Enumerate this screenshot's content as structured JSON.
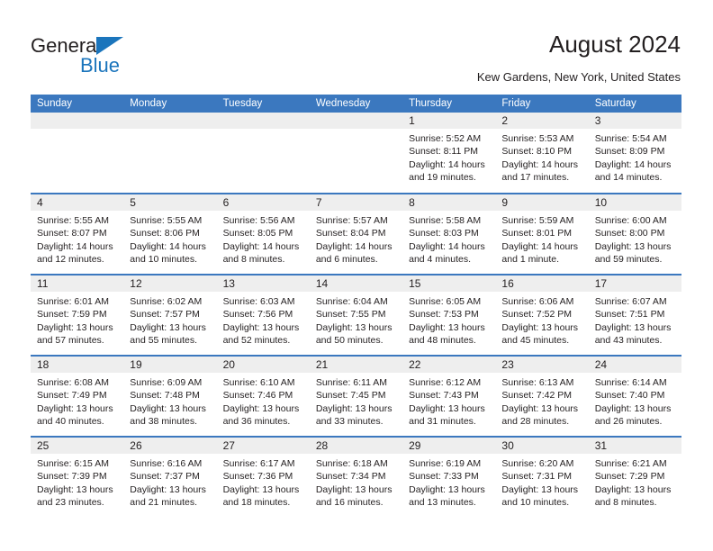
{
  "brand": {
    "name_top": "General",
    "name_bottom": "Blue",
    "triangle_icon": "triangle-icon",
    "color_dark": "#231f20",
    "color_blue": "#1b75bc"
  },
  "header": {
    "title": "August 2024",
    "subtitle": "Kew Gardens, New York, United States"
  },
  "calendar": {
    "header_bg": "#3b78bf",
    "daynum_bg": "#eeeeee",
    "weekday_headers": [
      "Sunday",
      "Monday",
      "Tuesday",
      "Wednesday",
      "Thursday",
      "Friday",
      "Saturday"
    ],
    "weeks": [
      [
        {
          "empty": true
        },
        {
          "empty": true
        },
        {
          "empty": true
        },
        {
          "empty": true
        },
        {
          "day": "1",
          "sunrise": "Sunrise: 5:52 AM",
          "sunset": "Sunset: 8:11 PM",
          "daylight1": "Daylight: 14 hours",
          "daylight2": "and 19 minutes."
        },
        {
          "day": "2",
          "sunrise": "Sunrise: 5:53 AM",
          "sunset": "Sunset: 8:10 PM",
          "daylight1": "Daylight: 14 hours",
          "daylight2": "and 17 minutes."
        },
        {
          "day": "3",
          "sunrise": "Sunrise: 5:54 AM",
          "sunset": "Sunset: 8:09 PM",
          "daylight1": "Daylight: 14 hours",
          "daylight2": "and 14 minutes."
        }
      ],
      [
        {
          "day": "4",
          "sunrise": "Sunrise: 5:55 AM",
          "sunset": "Sunset: 8:07 PM",
          "daylight1": "Daylight: 14 hours",
          "daylight2": "and 12 minutes."
        },
        {
          "day": "5",
          "sunrise": "Sunrise: 5:55 AM",
          "sunset": "Sunset: 8:06 PM",
          "daylight1": "Daylight: 14 hours",
          "daylight2": "and 10 minutes."
        },
        {
          "day": "6",
          "sunrise": "Sunrise: 5:56 AM",
          "sunset": "Sunset: 8:05 PM",
          "daylight1": "Daylight: 14 hours",
          "daylight2": "and 8 minutes."
        },
        {
          "day": "7",
          "sunrise": "Sunrise: 5:57 AM",
          "sunset": "Sunset: 8:04 PM",
          "daylight1": "Daylight: 14 hours",
          "daylight2": "and 6 minutes."
        },
        {
          "day": "8",
          "sunrise": "Sunrise: 5:58 AM",
          "sunset": "Sunset: 8:03 PM",
          "daylight1": "Daylight: 14 hours",
          "daylight2": "and 4 minutes."
        },
        {
          "day": "9",
          "sunrise": "Sunrise: 5:59 AM",
          "sunset": "Sunset: 8:01 PM",
          "daylight1": "Daylight: 14 hours",
          "daylight2": "and 1 minute."
        },
        {
          "day": "10",
          "sunrise": "Sunrise: 6:00 AM",
          "sunset": "Sunset: 8:00 PM",
          "daylight1": "Daylight: 13 hours",
          "daylight2": "and 59 minutes."
        }
      ],
      [
        {
          "day": "11",
          "sunrise": "Sunrise: 6:01 AM",
          "sunset": "Sunset: 7:59 PM",
          "daylight1": "Daylight: 13 hours",
          "daylight2": "and 57 minutes."
        },
        {
          "day": "12",
          "sunrise": "Sunrise: 6:02 AM",
          "sunset": "Sunset: 7:57 PM",
          "daylight1": "Daylight: 13 hours",
          "daylight2": "and 55 minutes."
        },
        {
          "day": "13",
          "sunrise": "Sunrise: 6:03 AM",
          "sunset": "Sunset: 7:56 PM",
          "daylight1": "Daylight: 13 hours",
          "daylight2": "and 52 minutes."
        },
        {
          "day": "14",
          "sunrise": "Sunrise: 6:04 AM",
          "sunset": "Sunset: 7:55 PM",
          "daylight1": "Daylight: 13 hours",
          "daylight2": "and 50 minutes."
        },
        {
          "day": "15",
          "sunrise": "Sunrise: 6:05 AM",
          "sunset": "Sunset: 7:53 PM",
          "daylight1": "Daylight: 13 hours",
          "daylight2": "and 48 minutes."
        },
        {
          "day": "16",
          "sunrise": "Sunrise: 6:06 AM",
          "sunset": "Sunset: 7:52 PM",
          "daylight1": "Daylight: 13 hours",
          "daylight2": "and 45 minutes."
        },
        {
          "day": "17",
          "sunrise": "Sunrise: 6:07 AM",
          "sunset": "Sunset: 7:51 PM",
          "daylight1": "Daylight: 13 hours",
          "daylight2": "and 43 minutes."
        }
      ],
      [
        {
          "day": "18",
          "sunrise": "Sunrise: 6:08 AM",
          "sunset": "Sunset: 7:49 PM",
          "daylight1": "Daylight: 13 hours",
          "daylight2": "and 40 minutes."
        },
        {
          "day": "19",
          "sunrise": "Sunrise: 6:09 AM",
          "sunset": "Sunset: 7:48 PM",
          "daylight1": "Daylight: 13 hours",
          "daylight2": "and 38 minutes."
        },
        {
          "day": "20",
          "sunrise": "Sunrise: 6:10 AM",
          "sunset": "Sunset: 7:46 PM",
          "daylight1": "Daylight: 13 hours",
          "daylight2": "and 36 minutes."
        },
        {
          "day": "21",
          "sunrise": "Sunrise: 6:11 AM",
          "sunset": "Sunset: 7:45 PM",
          "daylight1": "Daylight: 13 hours",
          "daylight2": "and 33 minutes."
        },
        {
          "day": "22",
          "sunrise": "Sunrise: 6:12 AM",
          "sunset": "Sunset: 7:43 PM",
          "daylight1": "Daylight: 13 hours",
          "daylight2": "and 31 minutes."
        },
        {
          "day": "23",
          "sunrise": "Sunrise: 6:13 AM",
          "sunset": "Sunset: 7:42 PM",
          "daylight1": "Daylight: 13 hours",
          "daylight2": "and 28 minutes."
        },
        {
          "day": "24",
          "sunrise": "Sunrise: 6:14 AM",
          "sunset": "Sunset: 7:40 PM",
          "daylight1": "Daylight: 13 hours",
          "daylight2": "and 26 minutes."
        }
      ],
      [
        {
          "day": "25",
          "sunrise": "Sunrise: 6:15 AM",
          "sunset": "Sunset: 7:39 PM",
          "daylight1": "Daylight: 13 hours",
          "daylight2": "and 23 minutes."
        },
        {
          "day": "26",
          "sunrise": "Sunrise: 6:16 AM",
          "sunset": "Sunset: 7:37 PM",
          "daylight1": "Daylight: 13 hours",
          "daylight2": "and 21 minutes."
        },
        {
          "day": "27",
          "sunrise": "Sunrise: 6:17 AM",
          "sunset": "Sunset: 7:36 PM",
          "daylight1": "Daylight: 13 hours",
          "daylight2": "and 18 minutes."
        },
        {
          "day": "28",
          "sunrise": "Sunrise: 6:18 AM",
          "sunset": "Sunset: 7:34 PM",
          "daylight1": "Daylight: 13 hours",
          "daylight2": "and 16 minutes."
        },
        {
          "day": "29",
          "sunrise": "Sunrise: 6:19 AM",
          "sunset": "Sunset: 7:33 PM",
          "daylight1": "Daylight: 13 hours",
          "daylight2": "and 13 minutes."
        },
        {
          "day": "30",
          "sunrise": "Sunrise: 6:20 AM",
          "sunset": "Sunset: 7:31 PM",
          "daylight1": "Daylight: 13 hours",
          "daylight2": "and 10 minutes."
        },
        {
          "day": "31",
          "sunrise": "Sunrise: 6:21 AM",
          "sunset": "Sunset: 7:29 PM",
          "daylight1": "Daylight: 13 hours",
          "daylight2": "and 8 minutes."
        }
      ]
    ]
  }
}
